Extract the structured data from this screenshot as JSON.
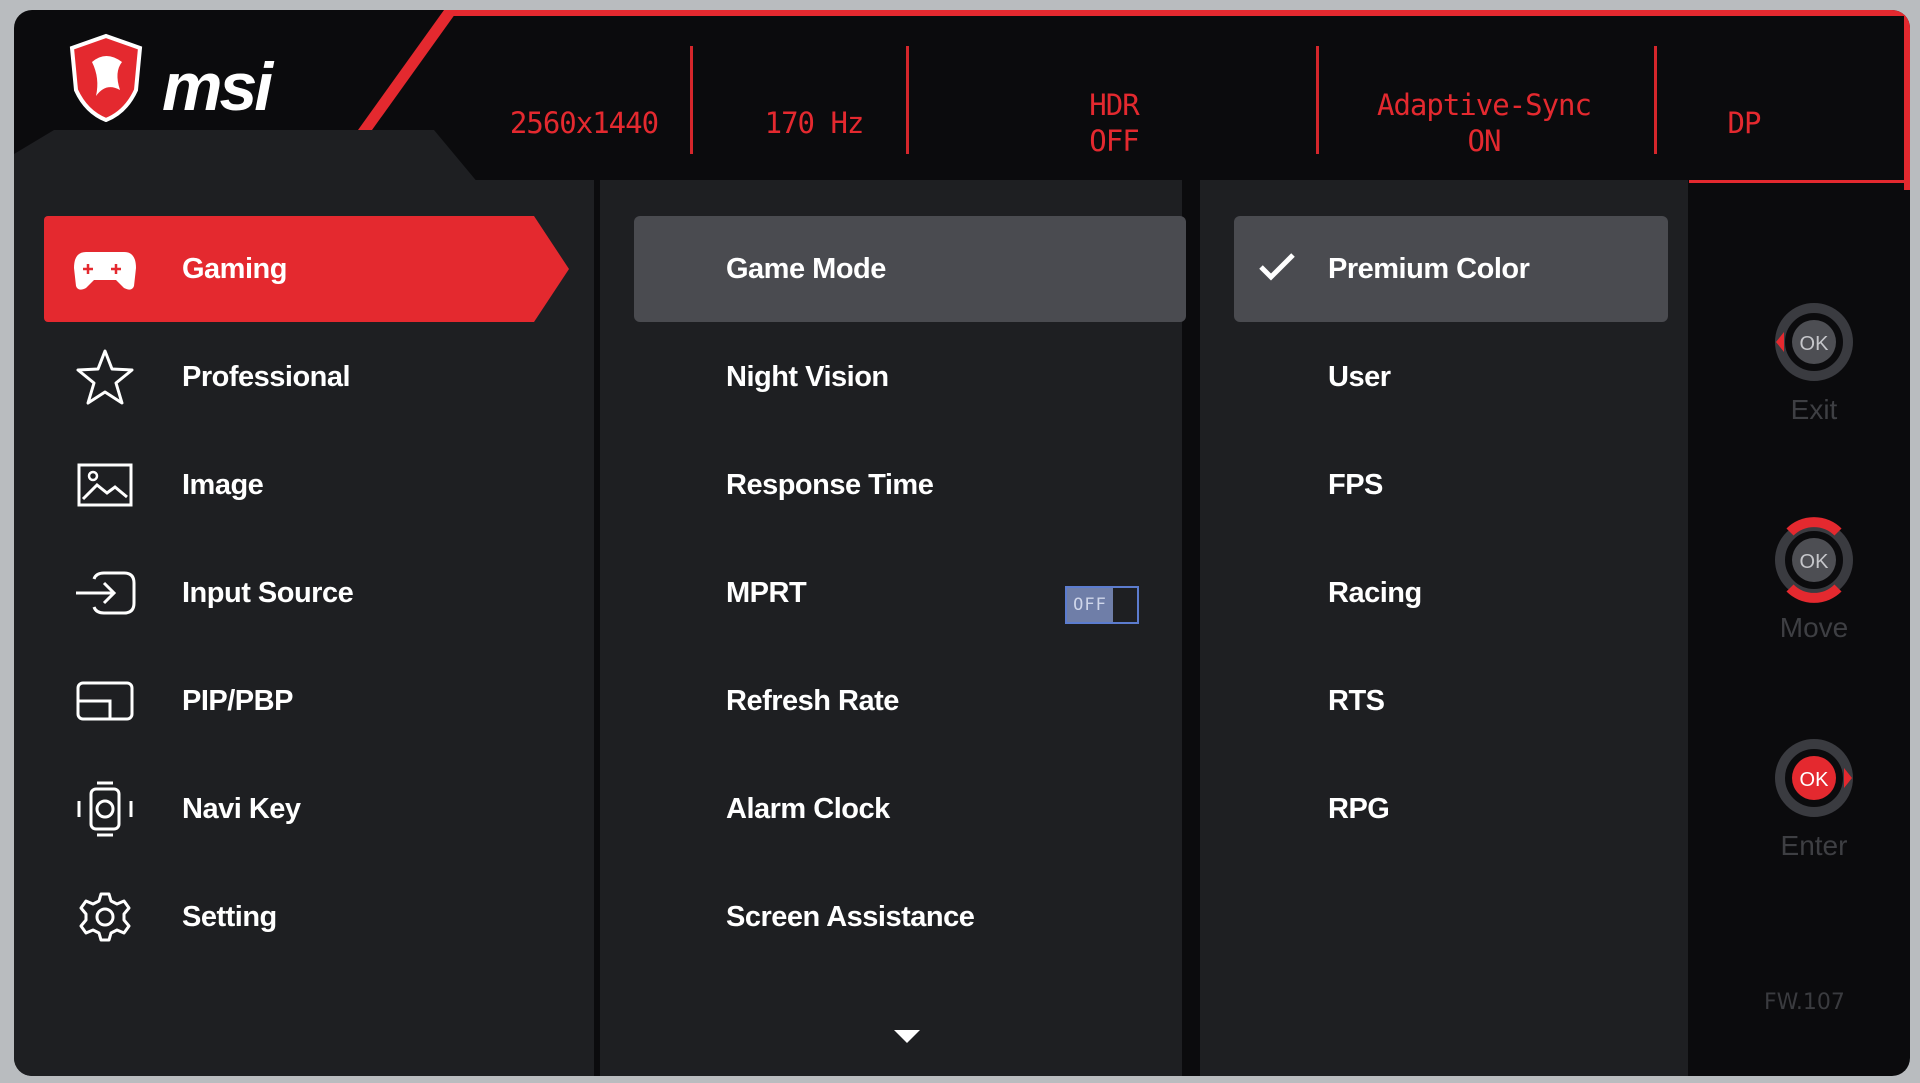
{
  "brand": {
    "name": "msi"
  },
  "status_bar": {
    "resolution": "2560x1440",
    "refresh": "170 Hz",
    "hdr_line1": "HDR",
    "hdr_line2": "OFF",
    "sync_line1": "Adaptive-Sync",
    "sync_line2": "ON",
    "input": "DP"
  },
  "main_menu": [
    {
      "label": "Gaming",
      "icon": "gamepad-icon",
      "active": true
    },
    {
      "label": "Professional",
      "icon": "star-icon"
    },
    {
      "label": "Image",
      "icon": "image-icon"
    },
    {
      "label": "Input Source",
      "icon": "input-icon"
    },
    {
      "label": "PIP/PBP",
      "icon": "pip-icon"
    },
    {
      "label": "Navi Key",
      "icon": "navi-key-icon"
    },
    {
      "label": "Setting",
      "icon": "gear-icon"
    }
  ],
  "sub_menu": [
    {
      "label": "Game Mode",
      "active": true
    },
    {
      "label": "Night Vision"
    },
    {
      "label": "Response Time"
    },
    {
      "label": "MPRT",
      "toggle": "OFF"
    },
    {
      "label": "Refresh Rate"
    },
    {
      "label": "Alarm Clock"
    },
    {
      "label": "Screen Assistance"
    }
  ],
  "options": [
    {
      "label": "Premium Color",
      "selected": true
    },
    {
      "label": "User"
    },
    {
      "label": "FPS"
    },
    {
      "label": "Racing"
    },
    {
      "label": "RTS"
    },
    {
      "label": "RPG"
    }
  ],
  "navi_hints": [
    {
      "label": "Exit",
      "pad_text": "OK"
    },
    {
      "label": "Move",
      "pad_text": "OK"
    },
    {
      "label": "Enter",
      "pad_text": "OK"
    }
  ],
  "firmware": "FW.107",
  "colors": {
    "accent": "#e4292f",
    "panel": "#1e1f22",
    "selected": "#4a4b50",
    "background": "#0b0b0d"
  }
}
